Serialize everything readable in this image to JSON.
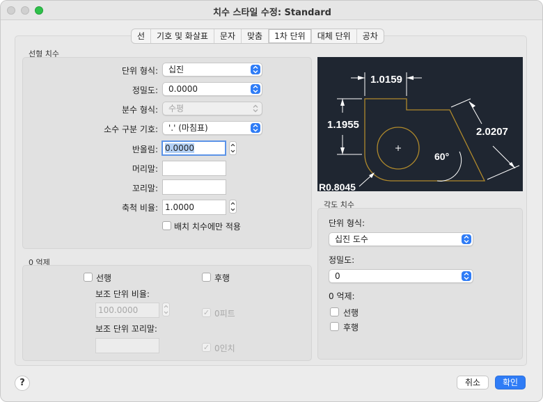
{
  "window": {
    "title": "치수 스타일 수정: Standard"
  },
  "tabs": [
    {
      "label": "선"
    },
    {
      "label": "기호 및 화살표"
    },
    {
      "label": "문자"
    },
    {
      "label": "맞춤"
    },
    {
      "label": "1차 단위",
      "active": true
    },
    {
      "label": "대체 단위"
    },
    {
      "label": "공차"
    }
  ],
  "linear": {
    "group_title": "선형 치수",
    "unit_format_label": "단위 형식:",
    "unit_format_value": "십진",
    "precision_label": "정밀도:",
    "precision_value": "0.0000",
    "fraction_format_label": "분수 형식:",
    "fraction_format_value": "수평",
    "decimal_separator_label": "소수 구분 기호:",
    "decimal_separator_value": "'.' (마침표)",
    "round_off_label": "반올림:",
    "round_off_value": "0.0000",
    "prefix_label": "머리말:",
    "prefix_value": "",
    "suffix_label": "꼬리말:",
    "suffix_value": "",
    "scale_factor_label": "축척 비율:",
    "scale_factor_value": "1.0000",
    "layout_only_label": "배치 치수에만 적용"
  },
  "zero_suppression": {
    "group_title": "0 억제",
    "leading_label": "선행",
    "trailing_label": "후행",
    "sub_unit_factor_label": "보조 단위 비율:",
    "sub_unit_factor_value": "100.0000",
    "sub_unit_suffix_label": "보조 단위 꼬리말:",
    "sub_unit_suffix_value": "",
    "feet_label": "0피트",
    "inches_label": "0인치"
  },
  "angular": {
    "group_title": "각도 치수",
    "unit_format_label": "단위 형식:",
    "unit_format_value": "십진 도수",
    "precision_label": "정밀도:",
    "precision_value": "0",
    "zero_suppression_label": "0 억제:",
    "leading_label": "선행",
    "trailing_label": "후행"
  },
  "preview": {
    "dim_top": "1.0159",
    "dim_left": "1.1955",
    "dim_right": "2.0207",
    "dim_angle": "60°",
    "dim_radius": "R0.8045",
    "colors": {
      "background": "#1f2631",
      "geometry": "#b08a2c",
      "dimension": "#ffffff"
    }
  },
  "buttons": {
    "help": "?",
    "cancel": "취소",
    "ok": "확인"
  },
  "colors": {
    "accent": "#2f7cf6",
    "window_bg": "#ececec"
  }
}
